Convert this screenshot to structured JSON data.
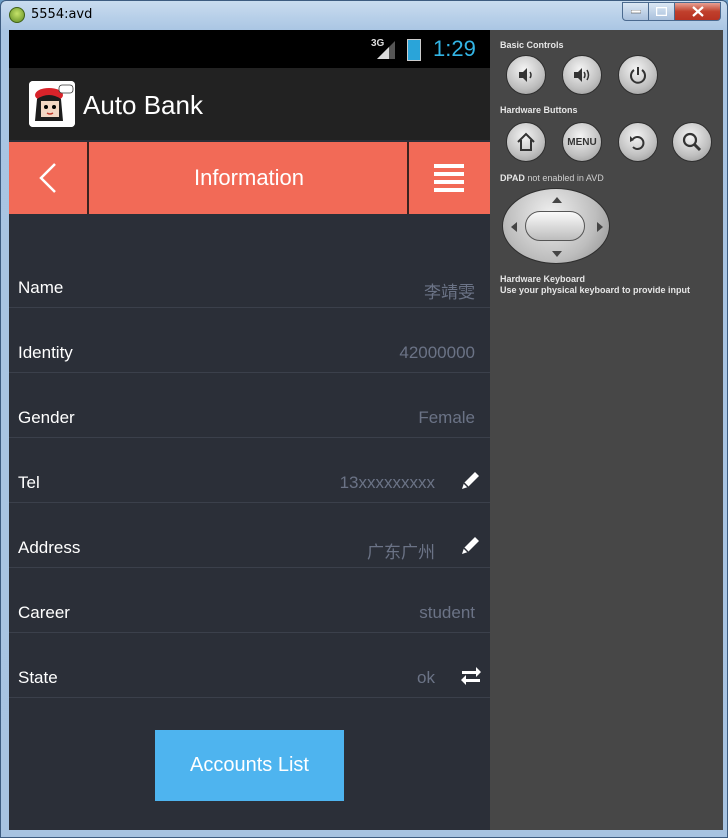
{
  "window": {
    "title": "5554:avd"
  },
  "status_bar": {
    "network": "3G",
    "time": "1:29"
  },
  "action_bar": {
    "app_title": "Auto Bank"
  },
  "top_bar": {
    "title": "Information"
  },
  "fields": [
    {
      "label": "Name",
      "value": "李靖雯",
      "icon": ""
    },
    {
      "label": "Identity",
      "value": "42000000",
      "icon": ""
    },
    {
      "label": "Gender",
      "value": "Female",
      "icon": ""
    },
    {
      "label": "Tel",
      "value": "13xxxxxxxxx",
      "icon": "pencil-icon"
    },
    {
      "label": "Address",
      "value": "广东广州",
      "icon": "pencil-icon"
    },
    {
      "label": "Career",
      "value": "student",
      "icon": ""
    },
    {
      "label": "State",
      "value": "ok",
      "icon": "swap-icon"
    }
  ],
  "accounts_button": {
    "label": "Accounts List"
  },
  "controls": {
    "basic_controls": "Basic Controls",
    "hardware_buttons": "Hardware Buttons",
    "menu_label": "MENU",
    "dpad_title": "DPAD",
    "dpad_note": "not enabled in AVD",
    "keyboard_title": "Hardware Keyboard",
    "keyboard_note": "Use your physical keyboard to provide input"
  },
  "colors": {
    "accent": "#f26a57",
    "button": "#4eb4ef",
    "background": "#2b2f38"
  }
}
